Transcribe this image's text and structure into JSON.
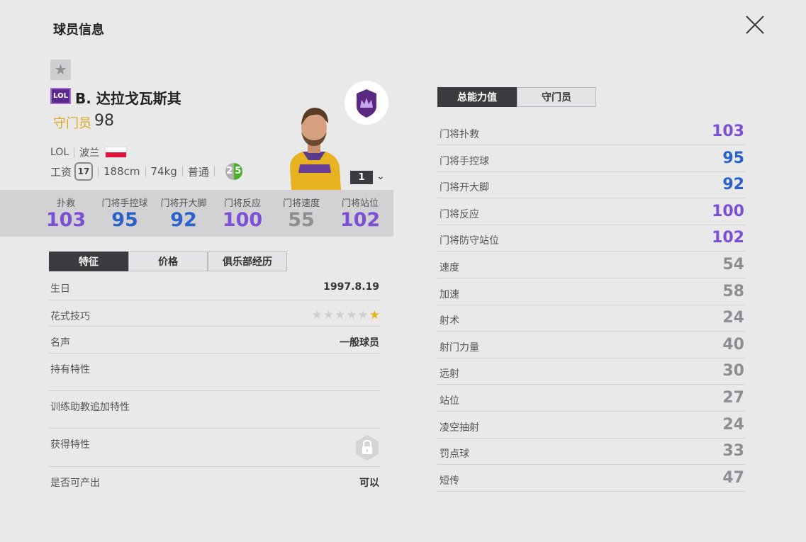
{
  "window": {
    "title": "球员信息"
  },
  "player": {
    "league_badge": "LOL",
    "name": "B. 达拉戈瓦斯其",
    "position": "守门员",
    "overall": "98",
    "season": "LOL",
    "nation": "波兰",
    "salary_label": "工资",
    "salary": "17",
    "height": "188cm",
    "weight": "74kg",
    "body_type": "普通",
    "weak_foot": "2",
    "strong_foot": "5",
    "level": "1"
  },
  "key_stats": [
    {
      "label": "扑救",
      "value": "103",
      "color": "#7b4fd6"
    },
    {
      "label": "门将手控球",
      "value": "95",
      "color": "#2a62c9"
    },
    {
      "label": "门将开大脚",
      "value": "92",
      "color": "#2a62c9"
    },
    {
      "label": "门将反应",
      "value": "100",
      "color": "#7b4fd6"
    },
    {
      "label": "门将速度",
      "value": "55",
      "color": "#8d8d92"
    },
    {
      "label": "门将站位",
      "value": "102",
      "color": "#7b4fd6"
    }
  ],
  "left_tabs": [
    "特征",
    "价格",
    "俱乐部经历"
  ],
  "info": {
    "birthday_label": "生日",
    "birthday": "1997.8.19",
    "skill_label": "花式技巧",
    "skill_stars": 1,
    "skill_max": 6,
    "reputation_label": "名声",
    "reputation": "一般球员",
    "traits_label": "持有特性",
    "coach_traits_label": "训练助教追加特性",
    "acquired_traits_label": "获得特性",
    "tradable_label": "是否可产出",
    "tradable": "可以"
  },
  "right_tabs": [
    "总能力值",
    "守门员"
  ],
  "abilities": [
    {
      "label": "门将扑救",
      "value": "103",
      "color": "#7b4fd6"
    },
    {
      "label": "门将手控球",
      "value": "95",
      "color": "#2a62c9"
    },
    {
      "label": "门将开大脚",
      "value": "92",
      "color": "#2a62c9"
    },
    {
      "label": "门将反应",
      "value": "100",
      "color": "#7b4fd6"
    },
    {
      "label": "门将防守站位",
      "value": "102",
      "color": "#7b4fd6"
    },
    {
      "label": "速度",
      "value": "54",
      "color": "#8d8d92"
    },
    {
      "label": "加速",
      "value": "58",
      "color": "#8d8d92"
    },
    {
      "label": "射术",
      "value": "24",
      "color": "#8d8d92"
    },
    {
      "label": "射门力量",
      "value": "40",
      "color": "#8d8d92"
    },
    {
      "label": "远射",
      "value": "30",
      "color": "#8d8d92"
    },
    {
      "label": "站位",
      "value": "27",
      "color": "#8d8d92"
    },
    {
      "label": "凌空抽射",
      "value": "24",
      "color": "#8d8d92"
    },
    {
      "label": "罚点球",
      "value": "33",
      "color": "#8d8d92"
    },
    {
      "label": "短传",
      "value": "47",
      "color": "#8d8d92"
    }
  ],
  "icons": {
    "close": "close-icon",
    "favorite": "star-icon",
    "team": "crown-crest-icon",
    "lock": "lock-icon",
    "dropdown": "chevron-down-icon"
  }
}
